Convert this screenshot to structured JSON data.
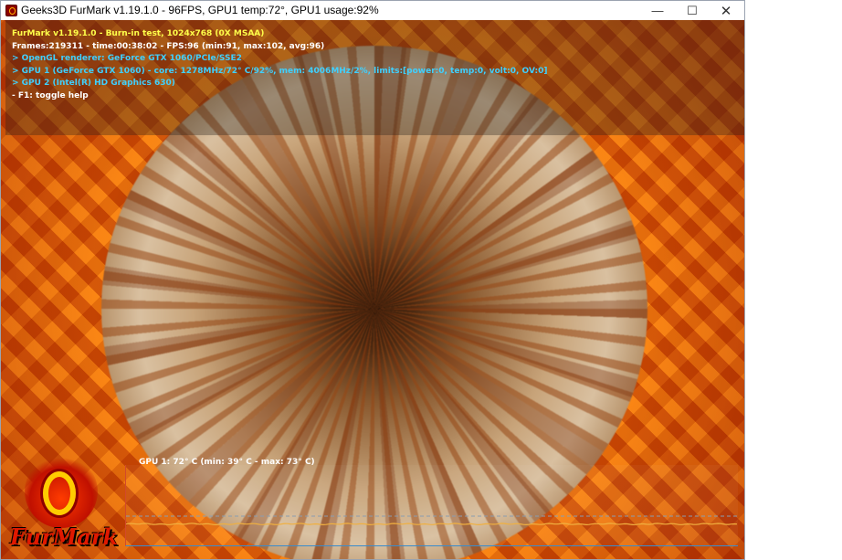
{
  "window": {
    "title": "Geeks3D FurMark v1.19.1.0 - 96FPS, GPU1 temp:72°, GPU1 usage:92%",
    "controls": {
      "minimize": "—",
      "maximize": "☐",
      "close": "✕"
    }
  },
  "hud": {
    "line1": "FurMark v1.19.1.0 - Burn-in test, 1024x768 (0X MSAA)",
    "line2": "Frames:219311 - time:00:38:02 - FPS:96 (min:91, max:102, avg:96)",
    "line3": "> OpenGL renderer: GeForce GTX 1060/PCIe/SSE2",
    "line4": "> GPU 1 (GeForce GTX 1060) - core: 1278MHz/72° C/92%, mem: 4006MHz/2%, limits:[power:0, temp:0, volt:0, OV:0]",
    "line5": "> GPU 2 (Intel(R) HD Graphics 630)",
    "line6": "- F1: toggle help"
  },
  "temperature_graph": {
    "label": "GPU 1: 72° C (min: 39° C - max: 73° C)",
    "current": 72,
    "min": 39,
    "max": 73,
    "line_color": "#f0b040"
  },
  "logo": {
    "text": "FurMark"
  },
  "colors": {
    "hud_yellow": "#ffff4a",
    "hud_white": "#ffffff",
    "hud_cyan": "#3fd0ff"
  }
}
